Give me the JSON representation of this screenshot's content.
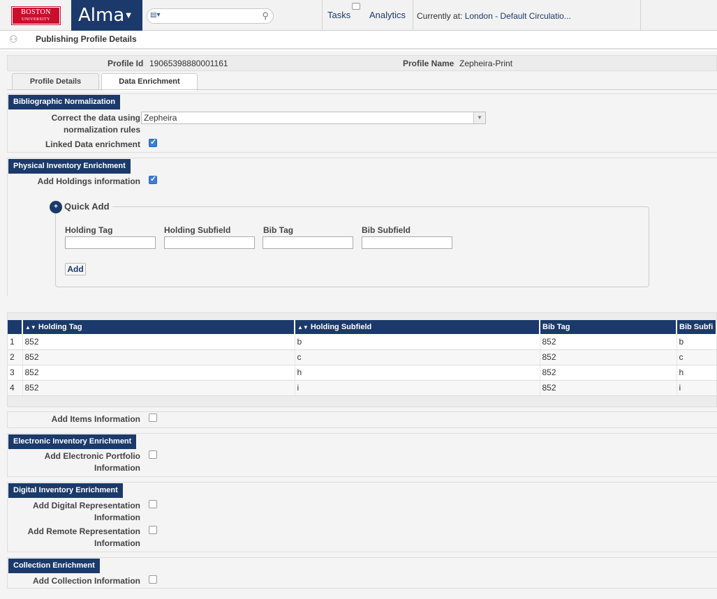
{
  "header": {
    "logo_line1": "BOSTON",
    "logo_line2": "UNIVERSITY",
    "app_name": "Alma",
    "tasks": "Tasks",
    "analytics": "Analytics",
    "currently_at_label": "Currently at:",
    "currently_at_value": "London - Default Circulatio..."
  },
  "page": {
    "title": "Publishing Profile Details"
  },
  "profile": {
    "id_label": "Profile Id",
    "id_value": "19065398880001161",
    "name_label": "Profile Name",
    "name_value": "Zepheira-Print"
  },
  "tabs": [
    {
      "label": "Profile Details",
      "active": false
    },
    {
      "label": "Data Enrichment",
      "active": true
    }
  ],
  "bib_norm": {
    "title": "Bibliographic Normalization",
    "correct_label_1": "Correct the data using",
    "correct_label_2": "normalization rules",
    "correct_value": "Zepheira",
    "linked_label": "Linked Data enrichment",
    "linked_checked": true
  },
  "physical": {
    "title": "Physical Inventory Enrichment",
    "holdings_label": "Add Holdings information",
    "holdings_checked": true,
    "quick_add": {
      "title": "Quick Add",
      "holding_tag": "Holding Tag",
      "holding_subfield": "Holding Subfield",
      "bib_tag": "Bib Tag",
      "bib_subfield": "Bib Subfield",
      "add_button": "Add"
    },
    "table": {
      "headers": [
        "Holding Tag",
        "Holding Subfield",
        "Bib Tag",
        "Bib Subfi"
      ],
      "rows": [
        [
          "1",
          "852",
          "b",
          "852",
          "b"
        ],
        [
          "2",
          "852",
          "c",
          "852",
          "c"
        ],
        [
          "3",
          "852",
          "h",
          "852",
          "h"
        ],
        [
          "4",
          "852",
          "i",
          "852",
          "i"
        ]
      ]
    },
    "items_label": "Add Items Information",
    "items_checked": false
  },
  "electronic": {
    "title": "Electronic Inventory Enrichment",
    "portfolio_label_1": "Add Electronic Portfolio",
    "portfolio_label_2": "Information"
  },
  "digital": {
    "title": "Digital Inventory Enrichment",
    "rep_label_1": "Add Digital Representation",
    "rep_label_2": "Information",
    "remote_label_1": "Add Remote Representation",
    "remote_label_2": "Information"
  },
  "collection": {
    "title": "Collection Enrichment",
    "label": "Add Collection Information"
  }
}
